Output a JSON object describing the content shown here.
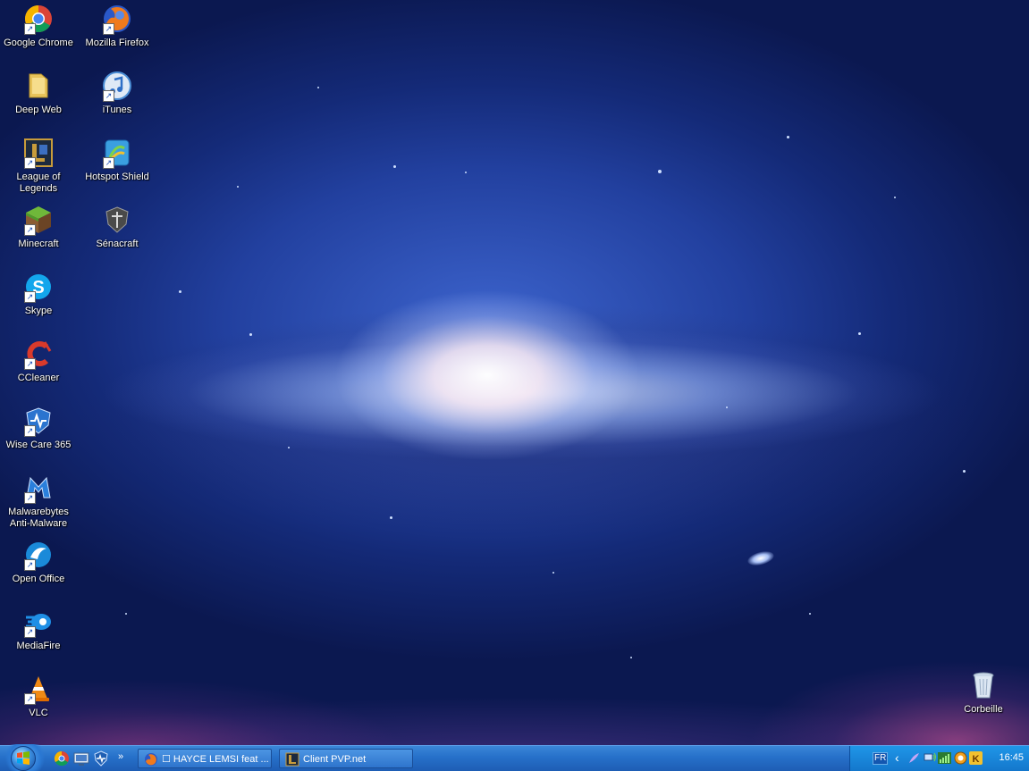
{
  "desktop_icons": [
    {
      "label": "Google Chrome",
      "icon": "chrome-icon"
    },
    {
      "label": "Mozilla Firefox",
      "icon": "firefox-icon"
    },
    {
      "label": "Deep Web",
      "icon": "folder-icon"
    },
    {
      "label": "iTunes",
      "icon": "itunes-icon"
    },
    {
      "label": "League of Legends",
      "icon": "league-of-legends-icon"
    },
    {
      "label": "Hotspot Shield",
      "icon": "hotspot-shield-icon"
    },
    {
      "label": "Minecraft",
      "icon": "minecraft-icon"
    },
    {
      "label": "Sénacraft",
      "icon": "senacraft-icon"
    },
    {
      "label": "Skype",
      "icon": "skype-icon"
    },
    {
      "label": "CCleaner",
      "icon": "ccleaner-icon"
    },
    {
      "label": "Wise Care 365",
      "icon": "wise-care-icon"
    },
    {
      "label": "Malwarebytes Anti-Malware",
      "icon": "malwarebytes-icon"
    },
    {
      "label": "Open Office",
      "icon": "openoffice-icon"
    },
    {
      "label": "MediaFire",
      "icon": "mediafire-icon"
    },
    {
      "label": "VLC",
      "icon": "vlc-icon"
    },
    {
      "label": "Corbeille",
      "icon": "recycle-bin-icon"
    }
  ],
  "taskbar": {
    "start_icon": "windows-logo-icon",
    "quick_launch": [
      "chrome-icon",
      "show-desktop-icon",
      "wise-care-icon"
    ],
    "quick_launch_more": "»",
    "tasks": [
      {
        "label": "☐ HAYCE LEMSI feat ...",
        "icon": "firefox-icon"
      },
      {
        "label": "Client PVP.net",
        "icon": "league-of-legends-icon"
      }
    ],
    "tray": {
      "language": "FR",
      "expand": "‹",
      "clock": "16:45"
    }
  },
  "colors": {
    "taskbar": "#2670c9",
    "tray": "#1477cc",
    "desktop_bg": "#142a78"
  }
}
